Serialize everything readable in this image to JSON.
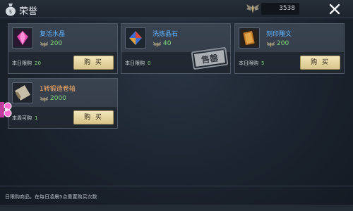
{
  "header": {
    "title": "荣誉",
    "currency_value": "3538"
  },
  "items": [
    {
      "name": "复活水晶",
      "name_color": "#5fb4ff",
      "price": "200",
      "limit_label": "本日限购",
      "limit_count": "20",
      "buy_label": "购 买",
      "icon": "pink-crystal-icon",
      "buyable": true
    },
    {
      "name": "洗炼晶石",
      "name_color": "#5fb4ff",
      "price": "40",
      "limit_label": "本日限购",
      "limit_count": "0",
      "buy_label": "",
      "icon": "refine-stone-icon",
      "buyable": false
    },
    {
      "name": "刻印雕文",
      "name_color": "#5fb4ff",
      "price": "200",
      "limit_label": "本日限购",
      "limit_count": "5",
      "buy_label": "购 买",
      "icon": "engrave-rune-icon",
      "buyable": true
    },
    {
      "name": "1转锻造卷轴",
      "name_color": "#ffb06a",
      "price": "2000",
      "limit_label": "本周可购",
      "limit_count": "1",
      "buy_label": "购 买",
      "icon": "forge-scroll-icon",
      "buyable": true
    }
  ],
  "sold_stamp": "售罄",
  "footer_note": "日限购商品，在每日凌晨5点重置购买次数",
  "colors": {
    "price_green": "#7fd67a",
    "limit_count_green": "#7fd67a",
    "buy_button": "#e9dba5"
  }
}
